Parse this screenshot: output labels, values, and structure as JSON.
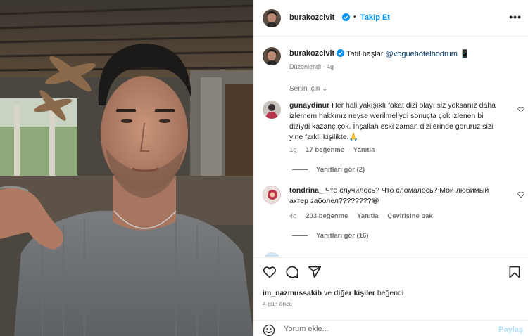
{
  "post": {
    "author": "burakozcivit",
    "follow_label": "Takip Et",
    "separator": "•",
    "more_label": "•••",
    "caption_text": "Tatil başlar",
    "caption_mention": "@voguehotelbodrum",
    "caption_emoji": "📱",
    "caption_meta": "Düzenlendi · 4g"
  },
  "sort_label": "Senin için ⌄",
  "comments": [
    {
      "user": "gunaydinur",
      "text": "Her hali yakışıklı fakat dizi olayı siz yoksanız daha izlemem hakkınız neyse werilmeliydi sonuçta çok izlenen bi diziydi kazanç çok. İnşallah eski zaman dizilerinde görürüz sizi yine farklı kişilikte.🙏",
      "age": "1g",
      "likes": "17 beğenme",
      "reply": "Yanıtla",
      "view_replies": "Yanıtları gör (2)"
    },
    {
      "user": "tondrina_",
      "text": "Что случилось? Что сломалось? Мой любимый актер заболел????????😁",
      "age": "4g",
      "likes": "203 beğenme",
      "reply": "Yanıtla",
      "translate": "Çevirisine bak",
      "view_replies": "Yanıtları gör (16)"
    }
  ],
  "liked_by": {
    "user": "im_nazmussakib",
    "connector": "ve",
    "others": "diğer kişiler",
    "suffix": "beğendi"
  },
  "post_age": "4 gün önce",
  "comment_input": {
    "placeholder": "Yorum ekle...",
    "value": ""
  },
  "post_button": "Paylaş",
  "icons": [
    "heart-icon",
    "comment-icon",
    "share-icon",
    "bookmark-icon",
    "verified-icon",
    "emoji-icon",
    "more-icon"
  ],
  "colors": {
    "link": "#0095f6",
    "mention": "#00376b",
    "muted": "#737373",
    "verified": "#0095f6"
  }
}
